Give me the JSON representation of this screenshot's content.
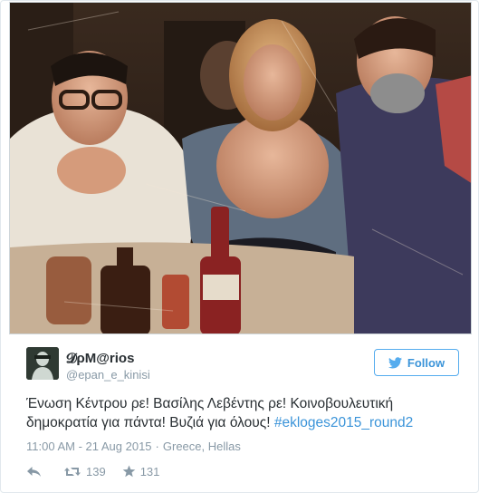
{
  "tweet": {
    "photo": {
      "icon": "tweet-photo",
      "alt": ""
    },
    "author": {
      "display_name": "𝓓ρM@rios",
      "handle": "@epan_e_kinisi",
      "avatar_icon": "user-avatar-icon"
    },
    "follow_button": {
      "label": "Follow",
      "icon": "twitter-bird-icon"
    },
    "text": {
      "line1": "Ένωση Κέντρου ρε! Βασίλης Λεβέντης ρε! Κοινοβουλευτική",
      "line2_plain": "δημοκρατία για πάντα! Βυζιά για όλους! ",
      "hashtag": "#ekloges2015_round2"
    },
    "meta": {
      "time": "11:00 AM - 21 Aug 2015",
      "separator": "·",
      "location": "Greece, Hellas"
    },
    "actions": {
      "reply_icon": "reply-icon",
      "retweet_icon": "retweet-icon",
      "retweet_count": "139",
      "favorite_icon": "star-icon",
      "favorite_count": "131"
    },
    "colors": {
      "link": "#3b94d9",
      "muted": "#8899a6",
      "text": "#292f33",
      "border": "#e1e8ed"
    }
  }
}
